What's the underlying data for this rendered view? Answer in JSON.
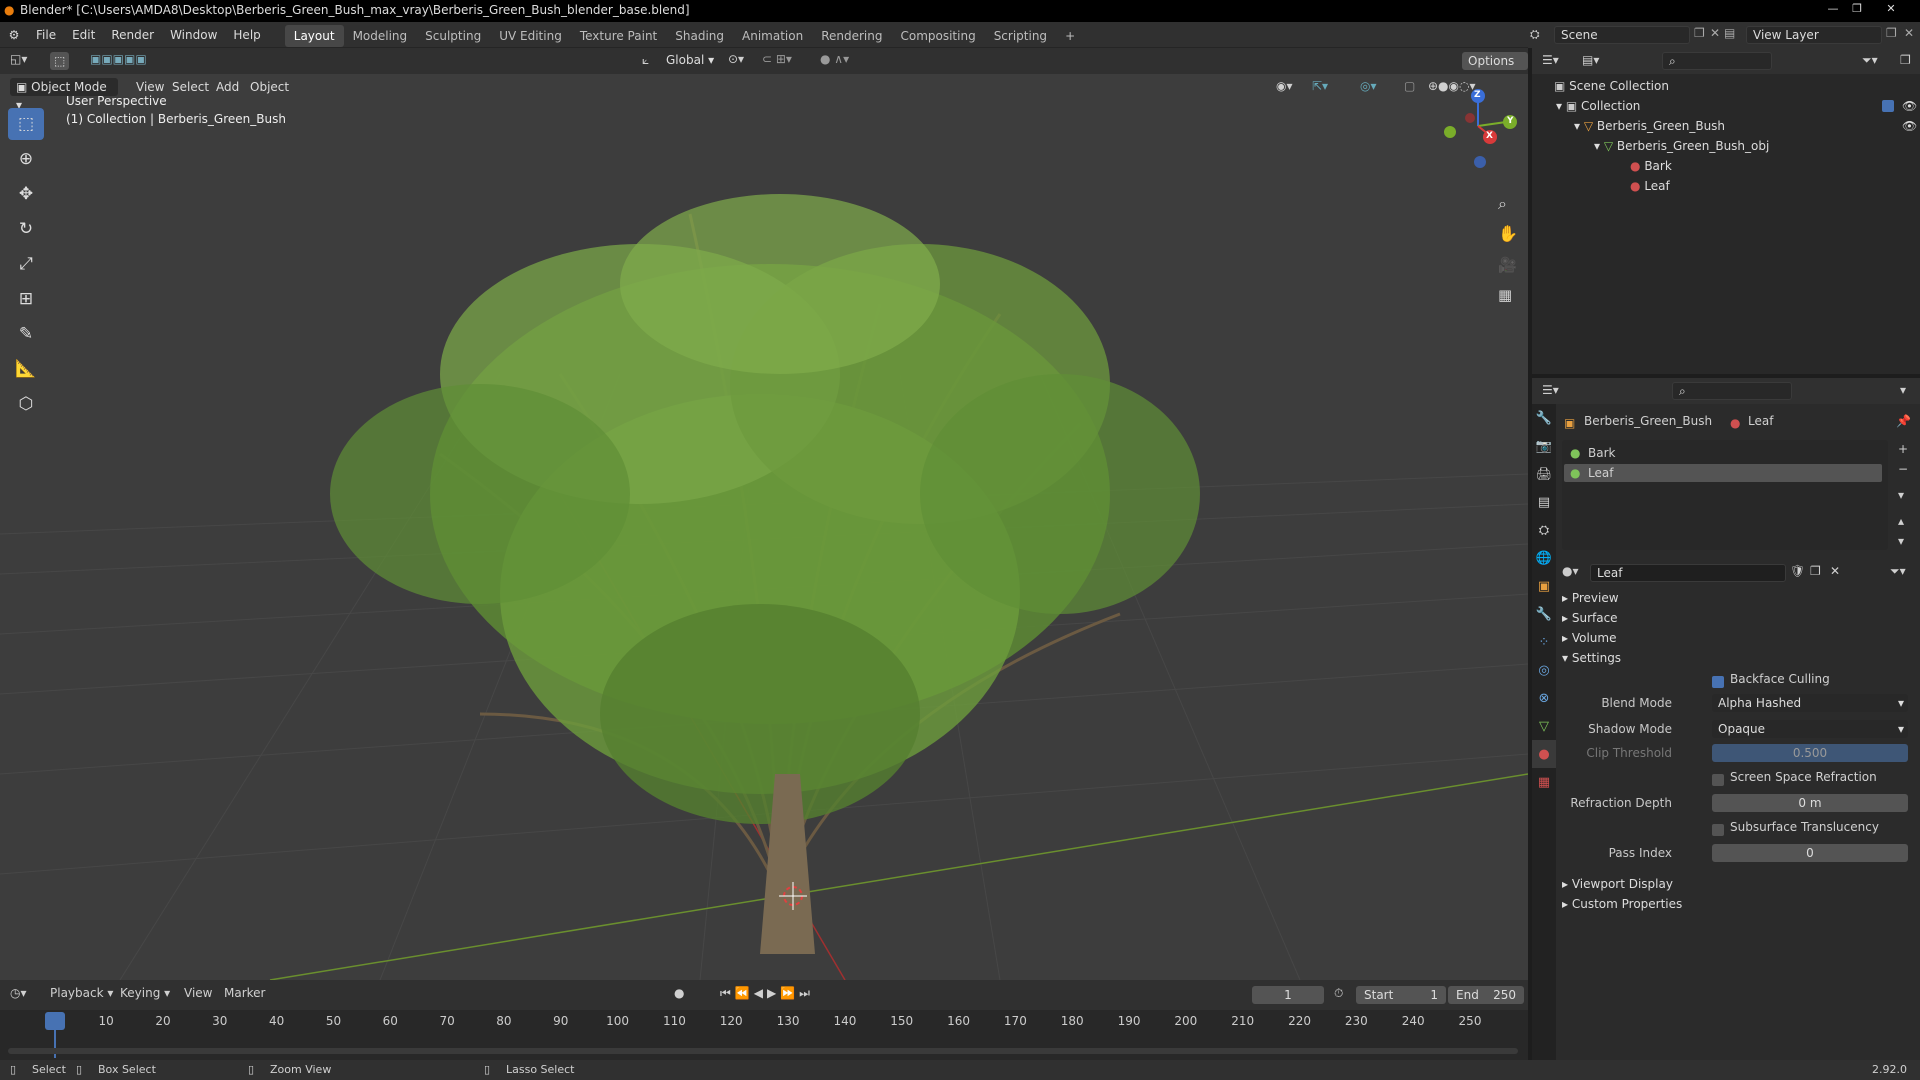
{
  "title_bar": {
    "text": "Blender* [C:\\Users\\AMDA8\\Desktop\\Berberis_Green_Bush_max_vray\\Berberis_Green_Bush_blender_base.blend]"
  },
  "menus": [
    "File",
    "Edit",
    "Render",
    "Window",
    "Help"
  ],
  "workspaces": [
    "Layout",
    "Modeling",
    "Sculpting",
    "UV Editing",
    "Texture Paint",
    "Shading",
    "Animation",
    "Rendering",
    "Compositing",
    "Scripting"
  ],
  "add_workspace": "+",
  "scene": {
    "name": "Scene",
    "view_layer": "View Layer"
  },
  "viewport": {
    "transform_orientation": "Global",
    "options": "Options",
    "mode": "Object Mode",
    "menus": [
      "View",
      "Select",
      "Add",
      "Object"
    ],
    "overlay_line1": "User Perspective",
    "overlay_line2": "(1) Collection | Berberis_Green_Bush",
    "gizmo": {
      "x": "X",
      "y": "Y",
      "z": "Z"
    }
  },
  "outliner": {
    "items": [
      {
        "label": "Scene Collection",
        "icon": "scene-collection-icon"
      },
      {
        "label": "Collection",
        "icon": "collection-icon"
      },
      {
        "label": "Berberis_Green_Bush",
        "icon": "object-icon"
      },
      {
        "label": "Berberis_Green_Bush_obj",
        "icon": "mesh-icon"
      },
      {
        "label": "Bark",
        "icon": "material-icon"
      },
      {
        "label": "Leaf",
        "icon": "material-icon"
      }
    ]
  },
  "properties": {
    "object_name": "Berberis_Green_Bush",
    "material_name": "Leaf",
    "slots": [
      "Bark",
      "Leaf"
    ],
    "material_field": "Leaf",
    "panels": {
      "preview": "Preview",
      "surface": "Surface",
      "volume": "Volume",
      "settings": "Settings",
      "viewport_display": "Viewport Display",
      "custom_properties": "Custom Properties"
    },
    "settings": {
      "backface_culling": "Backface Culling",
      "blend_mode_label": "Blend Mode",
      "blend_mode_value": "Alpha Hashed",
      "shadow_mode_label": "Shadow Mode",
      "shadow_mode_value": "Opaque",
      "clip_threshold_label": "Clip Threshold",
      "clip_threshold_value": "0.500",
      "screen_space_refraction": "Screen Space Refraction",
      "refraction_depth_label": "Refraction Depth",
      "refraction_depth_value": "0 m",
      "subsurface_translucency": "Subsurface Translucency",
      "pass_index_label": "Pass Index",
      "pass_index_value": "0"
    }
  },
  "timeline": {
    "menus": [
      "Playback",
      "Keying",
      "View",
      "Marker"
    ],
    "current_frame": "1",
    "start_label": "Start",
    "start_value": "1",
    "end_label": "End",
    "end_value": "250",
    "ticks": [
      "1",
      "10",
      "20",
      "30",
      "40",
      "50",
      "60",
      "70",
      "80",
      "90",
      "100",
      "110",
      "120",
      "130",
      "140",
      "150",
      "160",
      "170",
      "180",
      "190",
      "200",
      "210",
      "220",
      "230",
      "240",
      "250"
    ]
  },
  "status_bar": {
    "select": "Select",
    "box_select": "Box Select",
    "zoom_view": "Zoom View",
    "lasso_select": "Lasso Select",
    "version": "2.92.0"
  }
}
